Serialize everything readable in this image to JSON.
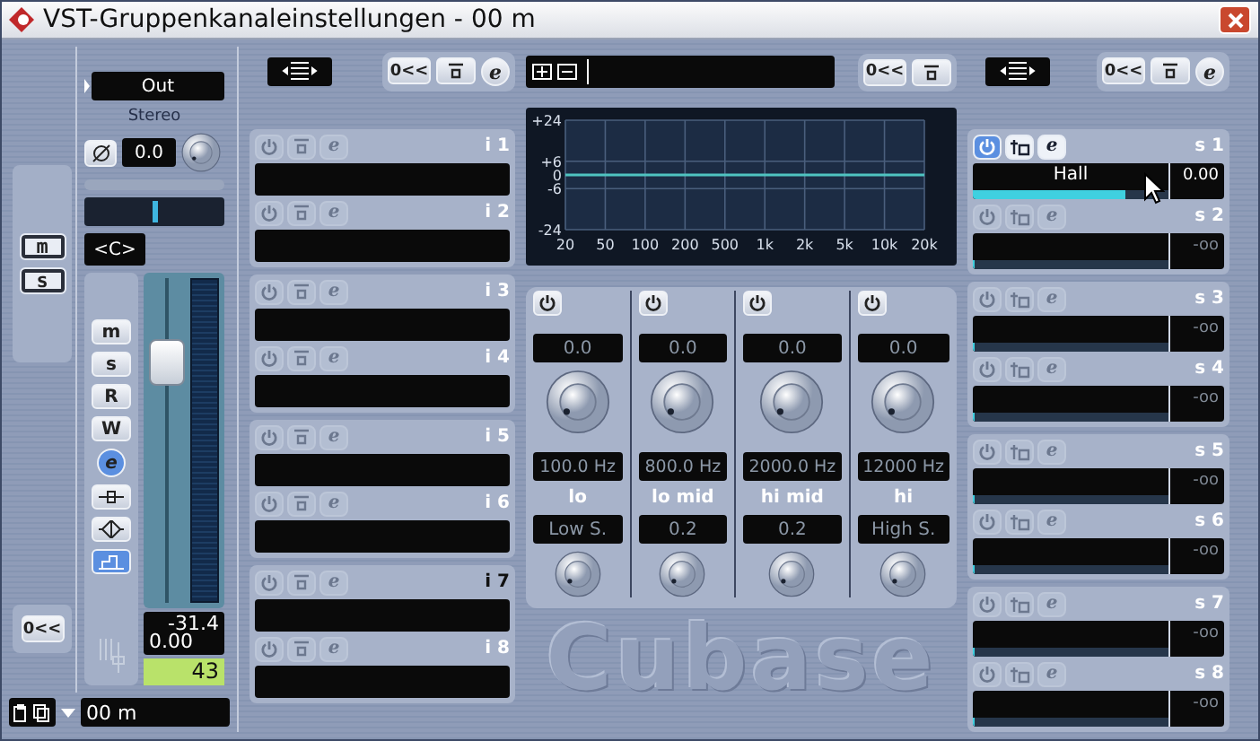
{
  "window": {
    "title": "VST-Gruppenkanaleinstellungen - 00 m"
  },
  "left_strip": {
    "buttons": [
      {
        "label": "m",
        "on": false
      },
      {
        "label": "s",
        "on": false
      }
    ],
    "reset": "0<<"
  },
  "channel": {
    "output": "Out",
    "format": "Stereo",
    "input_gain": "0.0",
    "pan": {
      "level": 0.5
    },
    "pan_label": "<C>",
    "buttons": [
      {
        "kind": "text",
        "label": "m",
        "on": false
      },
      {
        "kind": "text",
        "label": "s",
        "on": false
      },
      {
        "kind": "text",
        "label": "R",
        "on": false
      },
      {
        "kind": "text",
        "label": "W",
        "on": false
      },
      {
        "kind": "text",
        "label": "e",
        "on": true
      },
      {
        "kind": "line",
        "on": false
      },
      {
        "kind": "diamond",
        "on": false
      },
      {
        "kind": "step",
        "on": true
      }
    ],
    "fader": {
      "level": 0.78
    },
    "peak": "-31.4",
    "volume": "0.00",
    "number": "43",
    "name": "00 m"
  },
  "inserts": {
    "reset": "0<<",
    "edit": "e",
    "slots": [
      {
        "label": "i 1",
        "on": false,
        "edit": "e"
      },
      {
        "label": "i 2",
        "on": false,
        "edit": "e"
      },
      {
        "label": "i 3",
        "on": false,
        "edit": "e"
      },
      {
        "label": "i 4",
        "on": false,
        "edit": "e"
      },
      {
        "label": "i 5",
        "on": false,
        "edit": "e"
      },
      {
        "label": "i 6",
        "on": false,
        "edit": "e"
      },
      {
        "label": "i 7",
        "on": false,
        "edit": "e"
      },
      {
        "label": "i 8",
        "on": false,
        "edit": "e"
      }
    ]
  },
  "eq": {
    "reset": "0<<",
    "chart_data": {
      "type": "line",
      "categories": [
        "20",
        "50",
        "100",
        "200",
        "500",
        "1k",
        "2k",
        "5k",
        "10k",
        "20k"
      ],
      "series": [
        {
          "color": "#4fc3c0",
          "values": [
            0,
            0,
            0,
            0,
            0,
            0,
            0,
            0,
            0,
            0
          ]
        }
      ],
      "ylim": [
        -24,
        24
      ],
      "grid": true,
      "yticks": [
        {
          "value": 24,
          "label": "+24"
        },
        {
          "value": 6,
          "label": "+6"
        },
        {
          "value": 0,
          "label": "0"
        },
        {
          "value": -6,
          "label": "-6"
        },
        {
          "value": -24,
          "label": "-24"
        }
      ]
    },
    "bands": [
      {
        "on": false,
        "gain": "0.0",
        "frequency": "100.0 Hz",
        "name": "lo",
        "q": "Low S."
      },
      {
        "on": false,
        "gain": "0.0",
        "frequency": "800.0 Hz",
        "name": "lo mid",
        "q": "0.2"
      },
      {
        "on": false,
        "gain": "0.0",
        "frequency": "2000.0 Hz",
        "name": "hi mid",
        "q": "0.2"
      },
      {
        "on": false,
        "gain": "0.0",
        "frequency": "12000 Hz",
        "name": "hi",
        "q": "High S."
      }
    ]
  },
  "logo": "Cubase",
  "sends": {
    "reset": "0<<",
    "edit": "e",
    "slots": [
      {
        "label": "s 1",
        "on": true,
        "name": "Hall",
        "value": "0.00",
        "level": 0.78,
        "edit": "e"
      },
      {
        "label": "s 2",
        "on": false,
        "value": "-oo",
        "level": 0,
        "edit": "e"
      },
      {
        "label": "s 3",
        "on": false,
        "value": "-oo",
        "level": 0,
        "edit": "e"
      },
      {
        "label": "s 4",
        "on": false,
        "value": "-oo",
        "level": 0,
        "edit": "e"
      },
      {
        "label": "s 5",
        "on": false,
        "value": "-oo",
        "level": 0,
        "edit": "e"
      },
      {
        "label": "s 6",
        "on": false,
        "value": "-oo",
        "level": 0,
        "edit": "e"
      },
      {
        "label": "s 7",
        "on": false,
        "value": "-oo",
        "level": 0,
        "edit": "e"
      },
      {
        "label": "s 8",
        "on": false,
        "value": "-oo",
        "level": 0,
        "edit": "e"
      }
    ]
  }
}
